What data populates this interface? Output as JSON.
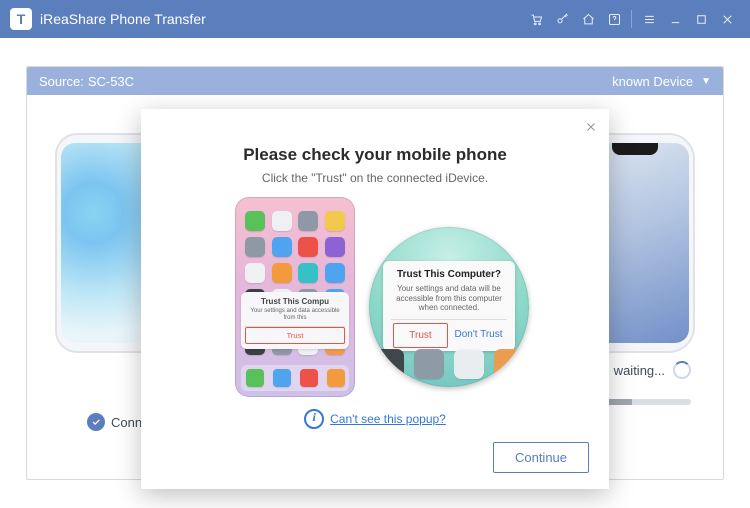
{
  "app": {
    "title": "iReaShare Phone Transfer",
    "logo_letter": "T"
  },
  "panel": {
    "source_label": "Source:",
    "source_device": "SC-53C",
    "dest_label": "known Device",
    "left_status": "Conn",
    "right_status": "puter, waiting...",
    "progress_percent": "50%",
    "progress_fill_width": "50%"
  },
  "dialog": {
    "title": "Please check your mobile phone",
    "subtitle": "Click the \"Trust\" on the connected iDevice.",
    "small_sheet": {
      "title": "Trust This Compu",
      "body": "Your settings and data accessible from this",
      "trust_btn": "Trust"
    },
    "mag_sheet": {
      "title": "Trust This Computer?",
      "body": "Your settings and data will be accessible from this computer when connected.",
      "trust_btn": "Trust",
      "dont_trust_btn": "Don't Trust"
    },
    "help_link": "Can't see this popup?",
    "continue_btn": "Continue"
  }
}
